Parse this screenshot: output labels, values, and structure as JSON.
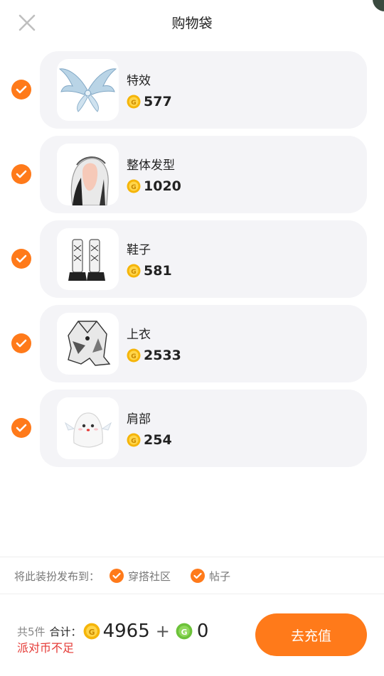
{
  "header": {
    "title": "购物袋"
  },
  "items": [
    {
      "name": "特效",
      "price": "577",
      "thumb": "wings-effect"
    },
    {
      "name": "整体发型",
      "price": "1020",
      "thumb": "hairstyle"
    },
    {
      "name": "鞋子",
      "price": "581",
      "thumb": "boots"
    },
    {
      "name": "上衣",
      "price": "2533",
      "thumb": "top"
    },
    {
      "name": "肩部",
      "price": "254",
      "thumb": "ghost-shoulder"
    }
  ],
  "publish": {
    "label": "将此装扮发布到：",
    "options": [
      "穿搭社区",
      "帖子"
    ]
  },
  "summary": {
    "count": "共5件",
    "total_label": "合计：",
    "coin_total": "4965",
    "plus": "+",
    "gcoin_total": "0",
    "warning": "派对币不足",
    "recharge_label": "去充值"
  },
  "colors": {
    "accent": "#ff7a1a",
    "warning": "#e53935",
    "card_bg": "#f4f4f7",
    "coin": "#f5b50a",
    "gcoin": "#6cc23a"
  }
}
